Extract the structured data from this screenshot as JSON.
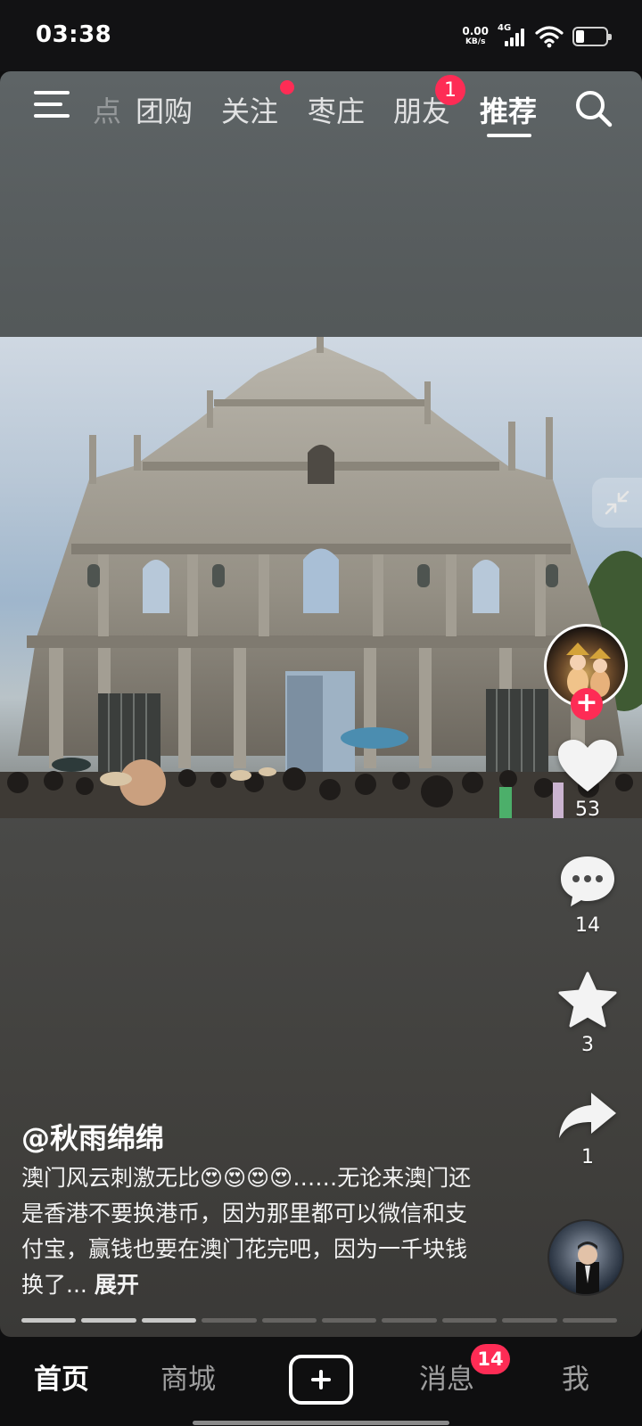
{
  "status_bar": {
    "time": "03:38",
    "net_speed": "0.00",
    "net_unit": "KB/s",
    "signal_label": "4G",
    "battery_level": 0.25
  },
  "top_nav": {
    "tabs": [
      {
        "label": "点",
        "state": "faded"
      },
      {
        "label": "团购"
      },
      {
        "label": "关注",
        "has_dot": true
      },
      {
        "label": "枣庄"
      },
      {
        "label": "朋友",
        "badge": "1"
      },
      {
        "label": "推荐",
        "state": "active"
      }
    ],
    "icons": {
      "menu": "menu-icon",
      "search": "search-icon"
    }
  },
  "video": {
    "author": "@秋雨绵绵",
    "caption": "澳门风云刺激无比😍😍😍😍……无论来澳门还是香港不要换港币，因为那里都可以微信和支付宝，赢钱也要在澳门花完吧，因为一千块钱换了...",
    "expand_label": "展开",
    "photo_segments": 10,
    "photo_current": 3
  },
  "actions": {
    "likes": "53",
    "comments": "14",
    "favorites": "3",
    "shares": "1",
    "follow_icon": "plus-icon"
  },
  "bottom_nav": {
    "items": [
      {
        "label": "首页",
        "state": "active"
      },
      {
        "label": "商城"
      },
      {
        "label": "消息",
        "badge": "14"
      },
      {
        "label": "我"
      }
    ],
    "create_icon": "plus-square-icon"
  },
  "colors": {
    "accent": "#fe2c55",
    "background": "#0f0f10"
  }
}
